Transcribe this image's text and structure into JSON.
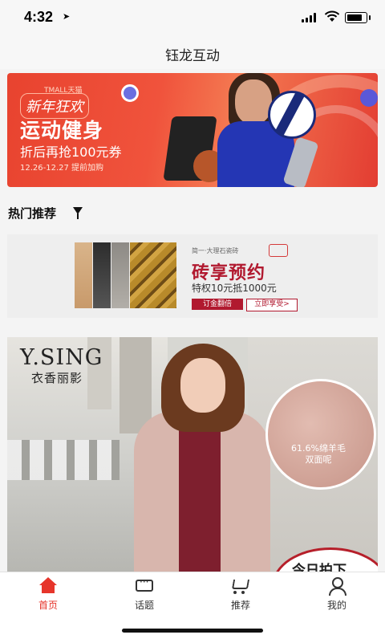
{
  "status_bar": {
    "time": "4:32"
  },
  "nav": {
    "title": "钰龙互动"
  },
  "banner1": {
    "tmall_tag": "TMALL天猫",
    "slogan": "新年狂欢",
    "headline": "运动健身",
    "subline": "折后再抢100元券",
    "dates": "12.26-12.27 提前加购"
  },
  "section": {
    "title": "热门推荐"
  },
  "banner2": {
    "brand": "简一·大理石瓷砖",
    "headline": "砖享预约",
    "subline": "特权10元抵1000元",
    "btn_left": "订金翻倍",
    "btn_right": "立即享受>"
  },
  "banner3": {
    "logo": "Y.SING",
    "logo_cn": "衣香丽影",
    "swatch_text_1": "61.6%绵羊毛",
    "swatch_text_2": "双面呢",
    "today": "今日拍下"
  },
  "tabs": [
    {
      "label": "首页",
      "active": true
    },
    {
      "label": "话题",
      "active": false
    },
    {
      "label": "推荐",
      "active": false
    },
    {
      "label": "我的",
      "active": false
    }
  ],
  "colors": {
    "accent": "#e6352b",
    "banner1_bg": "#e8432f",
    "banner2_text": "#b1192f"
  }
}
